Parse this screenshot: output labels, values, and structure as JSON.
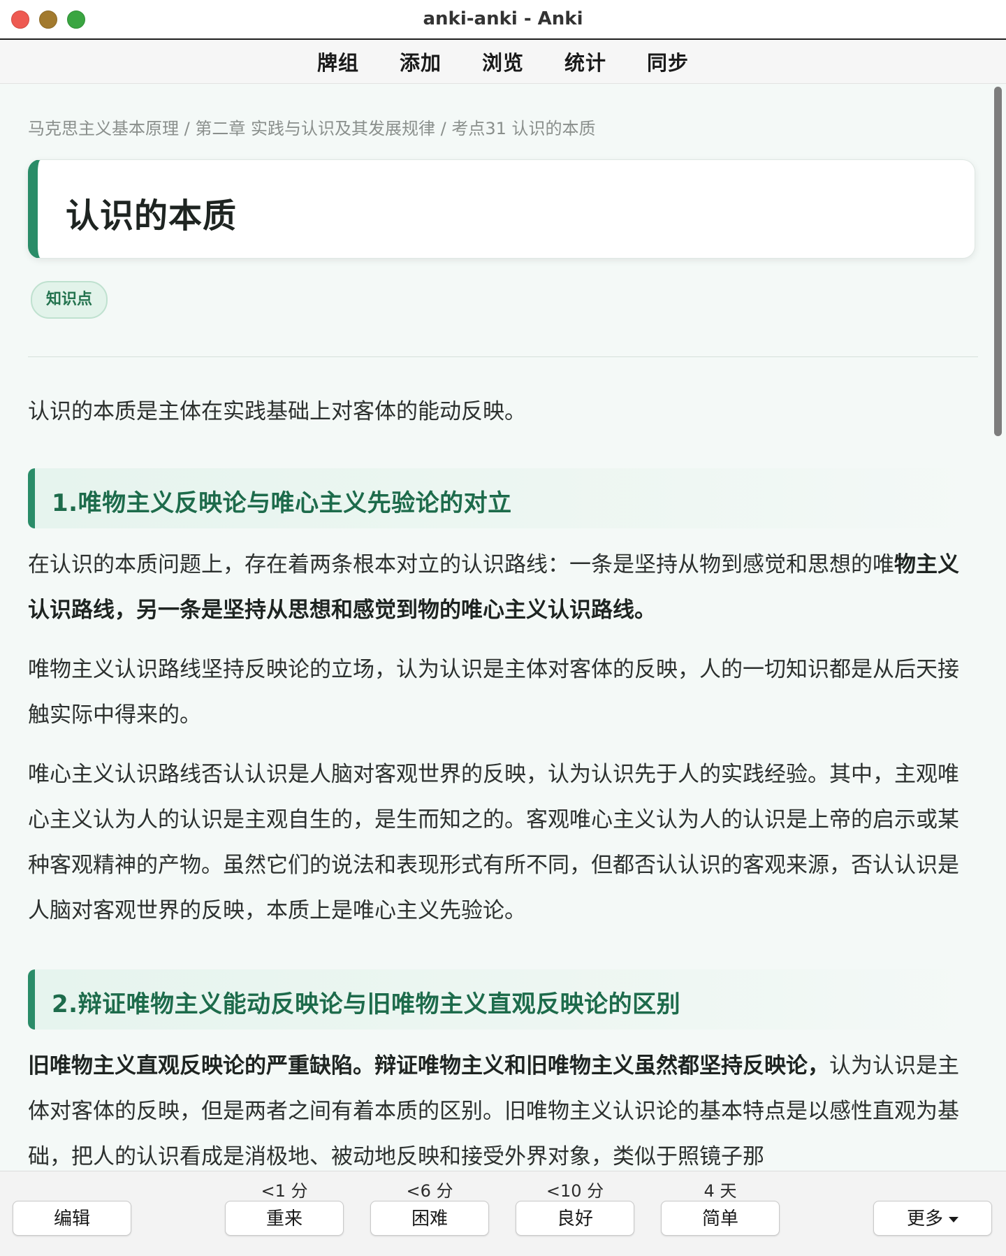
{
  "window": {
    "title": "anki-anki - Anki"
  },
  "toolbar": {
    "items": [
      "牌组",
      "添加",
      "浏览",
      "统计",
      "同步"
    ]
  },
  "card": {
    "breadcrumb": "马克思主义基本原理 / 第二章 实践与认识及其发展规律 / 考点31 认识的本质",
    "title": "认识的本质",
    "tag": "知识点",
    "intro": "认识的本质是主体在实践基础上对客体的能动反映。",
    "section1": {
      "heading": "1.唯物主义反映论与唯心主义先验论的对立",
      "p1_normal": "在认识的本质问题上，存在着两条根本对立的认识路线：一条是坚持从物到感觉和思想的唯",
      "p1_bold": "物主义认识路线，另一条是坚持从思想和感觉到物的唯心主义认识路线。",
      "p2": "唯物主义认识路线坚持反映论的立场，认为认识是主体对客体的反映，人的一切知识都是从后天接触实际中得来的。",
      "p3": "唯心主义认识路线否认认识是人脑对客观世界的反映，认为认识先于人的实践经验。其中，主观唯心主义认为人的认识是主观自生的，是生而知之的。客观唯心主义认为人的认识是上帝的启示或某种客观精神的产物。虽然它们的说法和表现形式有所不同，但都否认认识的客观来源，否认认识是人脑对客观世界的反映，本质上是唯心主义先验论。"
    },
    "section2": {
      "heading": "2.辩证唯物主义能动反映论与旧唯物主义直观反映论的区别",
      "p1_bold": "旧唯物主义直观反映论的严重缺陷。辩证唯物主义和旧唯物主义虽然都坚持反映论，",
      "p1_normal": "认为认识是主体对客体的反映，但是两者之间有着本质的区别。旧唯物主义认识论的基本特点是以感性直观为基础，把人的认识看成是消极地、被动地反映和接受外界对象，类似于照镜子那"
    }
  },
  "bottombar": {
    "edit_label": "编辑",
    "more_label": "更多",
    "answers": [
      {
        "interval": "<1 分",
        "label": "重来"
      },
      {
        "interval": "<6 分",
        "label": "困难"
      },
      {
        "interval": "<10 分",
        "label": "良好"
      },
      {
        "interval": "4 天",
        "label": "简单"
      }
    ]
  }
}
